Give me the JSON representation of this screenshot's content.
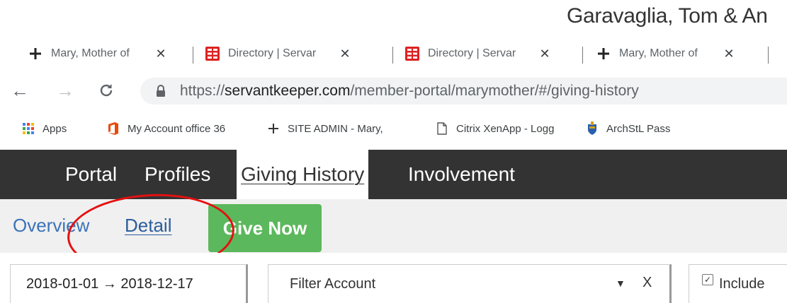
{
  "header": {
    "user_name": "Garavaglia, Tom & An"
  },
  "tabs": [
    {
      "title": "Mary, Mother of",
      "icon": "plus-icon"
    },
    {
      "title": "Directory | Servar",
      "icon": "servantkeeper-icon"
    },
    {
      "title": "Directory | Servar",
      "icon": "servantkeeper-icon"
    },
    {
      "title": "Mary, Mother of",
      "icon": "plus-icon"
    }
  ],
  "addressbar": {
    "url_scheme": "https://",
    "url_host": "servantkeeper.com",
    "url_path": "/member-portal/marymother/#/giving-history"
  },
  "bookmarks": [
    {
      "label": "Apps",
      "icon": "apps-grid-icon"
    },
    {
      "label": "My Account office 36",
      "icon": "office-icon"
    },
    {
      "label": "SITE ADMIN - Mary,",
      "icon": "plus-icon"
    },
    {
      "label": "Citrix XenApp - Logg",
      "icon": "page-icon"
    },
    {
      "label": "ArchStL Pass",
      "icon": "crest-icon"
    }
  ],
  "site_nav": {
    "items": [
      {
        "label": "Portal"
      },
      {
        "label": "Profiles"
      },
      {
        "label": "Giving History"
      },
      {
        "label": "Involvement"
      }
    ]
  },
  "sub_nav": {
    "overview": "Overview",
    "detail": "Detail",
    "give_now": "Give Now"
  },
  "filters": {
    "date_range": "2018-01-01 → 2018-12-17",
    "account_placeholder": "Filter Account",
    "clear": "X",
    "include_label": "Include"
  },
  "colors": {
    "nav_bg": "#333333",
    "link": "#3b73b9",
    "give_now": "#5cb85c",
    "annotation": "#e41010"
  }
}
